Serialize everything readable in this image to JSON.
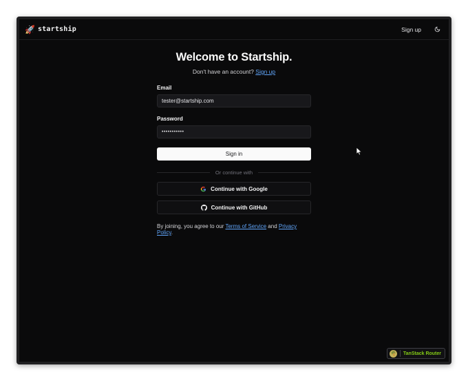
{
  "header": {
    "brand_name": "startship",
    "brand_icon": "rocket-icon",
    "signup_label": "Sign up",
    "theme_icon": "moon-icon"
  },
  "main": {
    "title": "Welcome to Startship.",
    "subtitle_prefix": "Don't have an account?",
    "subtitle_link": "Sign up"
  },
  "form": {
    "email_label": "Email",
    "email_value": "tester@startship.com",
    "password_label": "Password",
    "password_value": "•••••••••••",
    "submit_label": "Sign in",
    "divider_text": "Or continue with",
    "google_label": "Continue with Google",
    "github_label": "Continue with GitHub"
  },
  "terms": {
    "prefix": "By joining, you agree to our",
    "tos_link": "Terms of Service",
    "and": "and",
    "privacy_link": "Privacy Policy",
    "suffix": "."
  },
  "devtools": {
    "label": "TanStack Router",
    "icon": "tanstack-logo-icon"
  },
  "colors": {
    "background": "#0a0a0b",
    "link": "#60a5fa",
    "devtools_accent": "#84cc16"
  }
}
